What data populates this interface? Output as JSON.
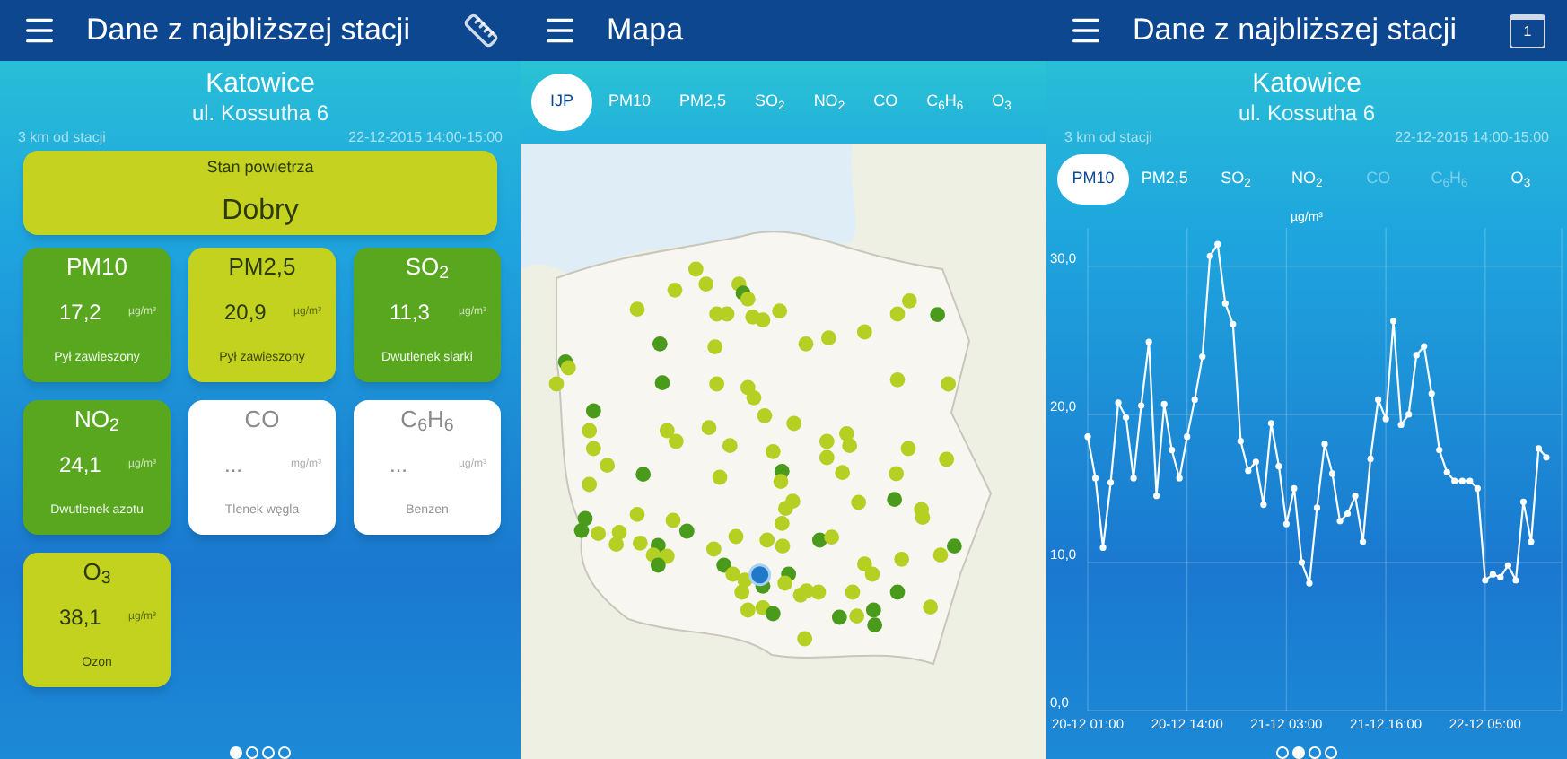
{
  "station_screen": {
    "title": "Dane z najbliższej stacji",
    "station": {
      "city": "Katowice",
      "address": "ul. Kossutha 6",
      "distance": "3 km od stacji",
      "time": "22-12-2015 14:00-15:00"
    },
    "air_quality": {
      "label": "Stan powietrza",
      "value": "Dobry",
      "color": "#c5d21f"
    },
    "tiles": [
      {
        "name": "PM10",
        "value": "17,2",
        "unit": "µg/m³",
        "description": "Pył zawieszony",
        "color": "#58a71f",
        "kind": "good"
      },
      {
        "name": "PM2,5",
        "value": "20,9",
        "unit": "µg/m³",
        "description": "Pył zawieszony",
        "color": "#c2d21f",
        "kind": "moderate"
      },
      {
        "name": "SO$_{2}$",
        "value": "11,3",
        "unit": "µg/m³",
        "description": "Dwutlenek siarki",
        "color": "#58a71f",
        "kind": "good"
      },
      {
        "name": "NO$_{2}$",
        "value": "24,1",
        "unit": "µg/m³",
        "description": "Dwutlenek azotu",
        "color": "#58a71f",
        "kind": "good"
      },
      {
        "name": "CO",
        "value": "...",
        "unit": "mg/m³",
        "description": "Tlenek węgla",
        "color": "#ffffff",
        "kind": "no_data"
      },
      {
        "name": "C$_{6}$H$_{6}$",
        "value": "...",
        "unit": "µg/m³",
        "description": "Benzen",
        "color": "#ffffff",
        "kind": "no_data"
      },
      {
        "name": "O$_{3}$",
        "value": "38,1",
        "unit": "µg/m³",
        "description": "Ozon",
        "color": "#c2d21f",
        "kind": "moderate"
      }
    ],
    "pages": [
      {
        "selected": true
      },
      {
        "selected": false
      },
      {
        "selected": false
      },
      {
        "selected": false
      }
    ]
  },
  "map_screen": {
    "title": "Mapa",
    "tabs": [
      {
        "label": "IJP",
        "selected": true
      },
      {
        "label": "PM10",
        "selected": false
      },
      {
        "label": "PM2,5",
        "selected": false
      },
      {
        "label": "SO$_{2}$",
        "selected": false
      },
      {
        "label": "NO$_{2}$",
        "selected": false
      },
      {
        "label": "CO",
        "selected": false
      },
      {
        "label": "C$_{6}$H$_{6}$",
        "selected": false
      },
      {
        "label": "O$_{3}$",
        "selected": false
      }
    ]
  },
  "chart_screen": {
    "title": "Dane z najbliższej stacji",
    "calendar_day": "1",
    "station": {
      "city": "Katowice",
      "address": "ul. Kossutha 6",
      "distance": "3 km od stacji",
      "time": "22-12-2015 14:00-15:00"
    },
    "tabs": [
      {
        "label": "PM10",
        "selected": true,
        "disabled": false
      },
      {
        "label": "PM2,5",
        "selected": false,
        "disabled": false
      },
      {
        "label": "SO$_{2}$",
        "selected": false,
        "disabled": false
      },
      {
        "label": "NO$_{2}$",
        "selected": false,
        "disabled": false
      },
      {
        "label": "CO",
        "selected": false,
        "disabled": true
      },
      {
        "label": "C$_{6}$H$_{6}$",
        "selected": false,
        "disabled": true
      },
      {
        "label": "O$_{3}$",
        "selected": false,
        "disabled": false
      }
    ],
    "chart_data": {
      "type": "line",
      "ylabel": "µg/m³",
      "categories": [
        "20-12 01:00",
        null,
        null,
        null,
        null,
        null,
        null,
        null,
        null,
        null,
        null,
        null,
        null,
        "20-12 14:00",
        null,
        null,
        null,
        null,
        null,
        null,
        null,
        null,
        null,
        null,
        null,
        null,
        "21-12 03:00",
        null,
        null,
        null,
        null,
        null,
        null,
        null,
        null,
        null,
        null,
        null,
        null,
        "21-12 16:00",
        null,
        null,
        null,
        null,
        null,
        null,
        null,
        null,
        null,
        null,
        null,
        null,
        "22-12 05:00",
        null,
        null,
        null,
        null,
        null,
        null,
        null,
        null
      ],
      "values": [
        18.5,
        15.7,
        11.0,
        15.4,
        20.8,
        19.8,
        15.7,
        20.6,
        24.9,
        14.5,
        20.7,
        17.6,
        15.7,
        18.5,
        21.0,
        23.9,
        30.7,
        31.5,
        27.5,
        26.1,
        18.2,
        16.2,
        16.8,
        13.9,
        19.4,
        16.5,
        12.6,
        15.0,
        10.0,
        8.6,
        13.7,
        18.0,
        16.0,
        12.8,
        13.3,
        14.5,
        11.4,
        17.0,
        21.0,
        19.7,
        26.3,
        19.3,
        20.0,
        24.0,
        24.6,
        21.4,
        17.6,
        16.1,
        15.5,
        15.5,
        15.5,
        15.0,
        8.8,
        9.2,
        9.0,
        9.8,
        8.8,
        14.1,
        11.4,
        17.7,
        17.1
      ],
      "ylim": [
        0,
        32.6
      ],
      "grid": true,
      "marker": true,
      "yticks": [
        {
          "value": 0,
          "label": "0,0"
        },
        {
          "value": 10,
          "label": "10,0"
        },
        {
          "value": 20,
          "label": "20,0"
        },
        {
          "value": 30,
          "label": "30,0"
        }
      ]
    },
    "pages": [
      {
        "selected": false
      },
      {
        "selected": true
      },
      {
        "selected": false
      },
      {
        "selected": false
      }
    ]
  }
}
